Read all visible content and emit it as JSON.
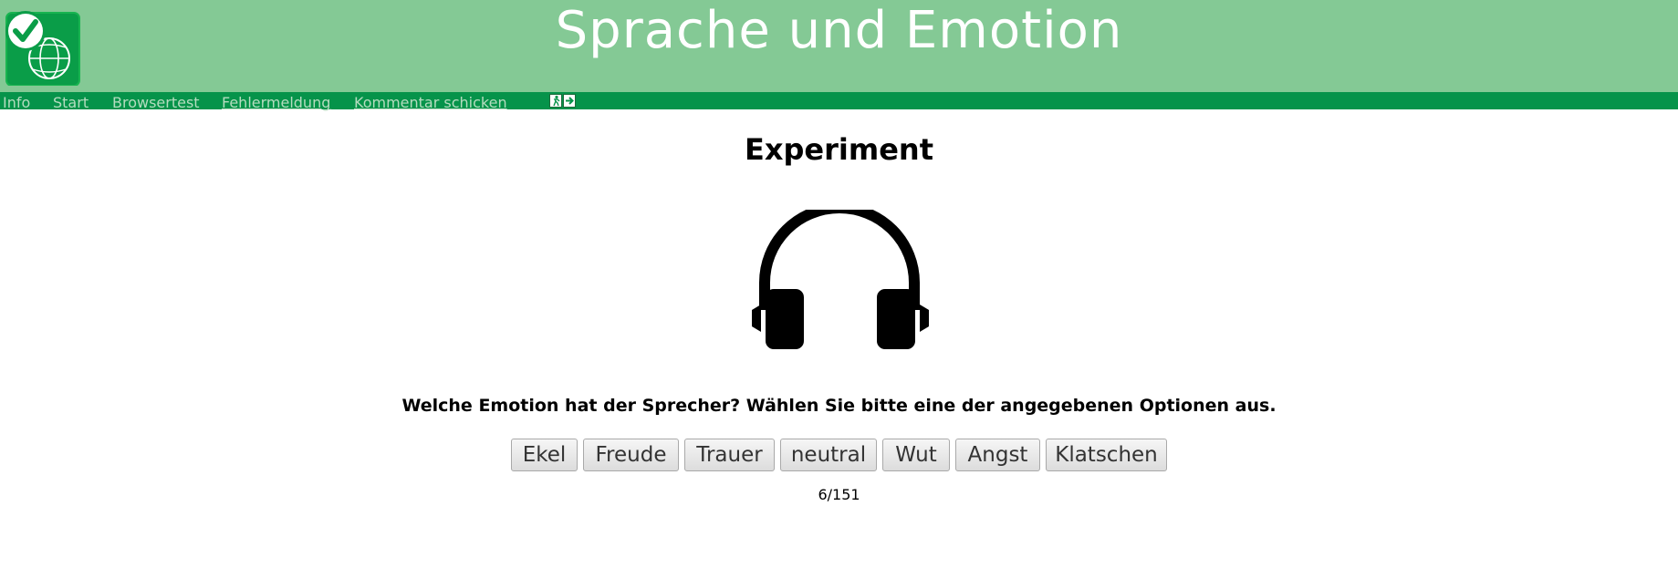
{
  "header": {
    "title": "Sprache und Emotion",
    "logo_icon": "checkmark-globe-logo",
    "background_color": "#84c995"
  },
  "nav": {
    "background_color": "#06934a",
    "items": [
      {
        "label": "Info"
      },
      {
        "label": "Start"
      },
      {
        "label": "Browsertest"
      },
      {
        "label": "Fehlermeldung"
      },
      {
        "label": "Kommentar schicken"
      }
    ],
    "exit_icon": "exit-door-arrow-icon"
  },
  "main": {
    "heading": "Experiment",
    "media_icon": "headphones-icon",
    "question": "Welche Emotion hat der Sprecher? Wählen Sie bitte eine der angegebenen Optionen aus.",
    "options": [
      "Ekel",
      "Freude",
      "Trauer",
      "neutral",
      "Wut",
      "Angst",
      "Klatschen"
    ],
    "progress": "6/151"
  }
}
